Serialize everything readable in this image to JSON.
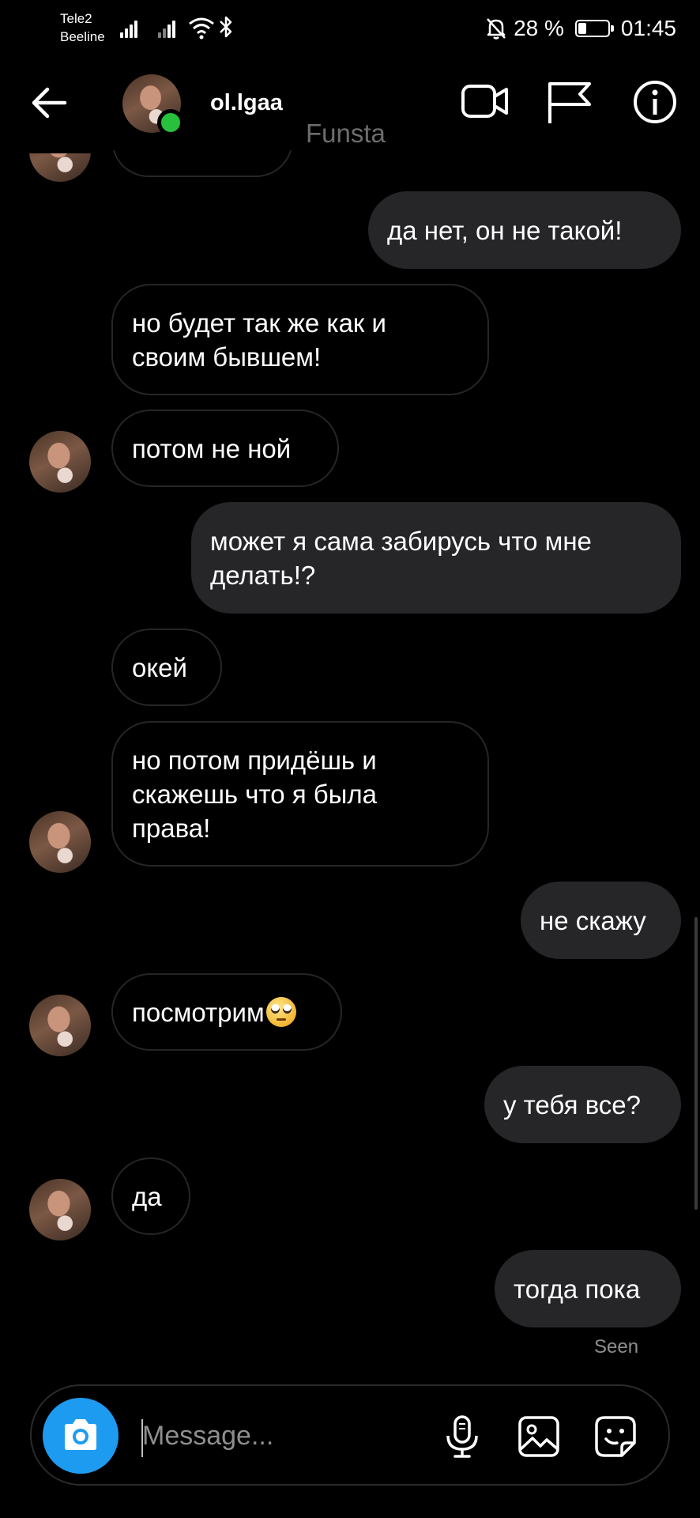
{
  "status_bar": {
    "carrier1": "Tele2",
    "carrier2": "Beeline",
    "battery_percent": "28 %",
    "battery_level": 0.28,
    "time": "01:45"
  },
  "header": {
    "username": "ol.lgaa",
    "subtitle": "Funsta"
  },
  "messages": [
    {
      "direction": "outgoing",
      "text": "да нет, он не такой!"
    },
    {
      "direction": "incoming",
      "text": "но будет так же как и\nсвоим бывшем!"
    },
    {
      "direction": "incoming",
      "text": "потом не ной"
    },
    {
      "direction": "outgoing",
      "text": "может я сама забирусь что мне\nделать!?"
    },
    {
      "direction": "incoming",
      "text": "окей"
    },
    {
      "direction": "incoming",
      "text": "но потом придёшь и\nскажешь что я была\nправа!"
    },
    {
      "direction": "outgoing",
      "text": "не скажу"
    },
    {
      "direction": "incoming",
      "text": "посмотрим",
      "emoji": "face-with-rolling-eyes"
    },
    {
      "direction": "outgoing",
      "text": "у тебя все?"
    },
    {
      "direction": "incoming",
      "text": "да"
    },
    {
      "direction": "outgoing",
      "text": "тогда пока"
    }
  ],
  "seen_label": "Seen",
  "composer": {
    "placeholder": "Message..."
  },
  "icons": {
    "back": "arrow-left-icon",
    "video_call": "video-camera-icon",
    "report": "flag-icon",
    "info": "info-icon",
    "camera": "camera-icon",
    "microphone": "microphone-icon",
    "gallery": "image-icon",
    "sticker": "sticker-icon"
  },
  "colors": {
    "background": "#000000",
    "outgoing_bubble": "#262629",
    "incoming_border": "#262626",
    "online": "#27c13d",
    "camera_button": "#1d9bf0",
    "muted_text": "#8e8e8e"
  }
}
